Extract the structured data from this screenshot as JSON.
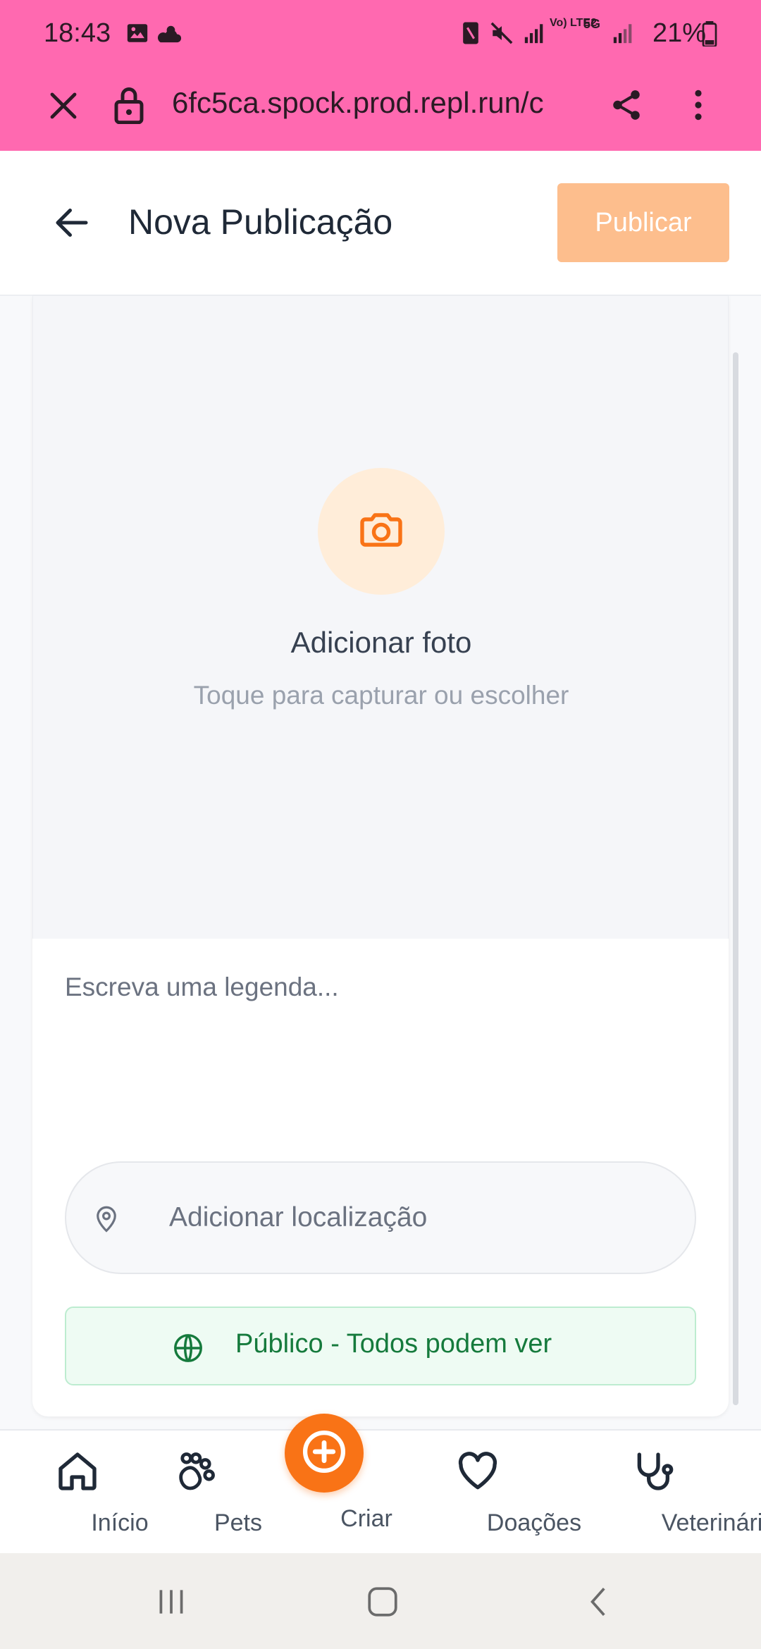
{
  "status_bar": {
    "time": "18:43",
    "battery_percent": "21%",
    "network": "5G",
    "lte_label": "Vo) LTE2"
  },
  "browser": {
    "url": "6fc5ca.spock.prod.repl.run/c"
  },
  "header": {
    "title": "Nova Publicação",
    "publish_label": "Publicar"
  },
  "photo": {
    "title": "Adicionar foto",
    "subtitle": "Toque para capturar ou escolher"
  },
  "caption": {
    "placeholder": "Escreva uma legenda..."
  },
  "location": {
    "placeholder": "Adicionar localização"
  },
  "visibility": {
    "label": "Público - Todos podem ver"
  },
  "bottom_nav": {
    "items": [
      {
        "label": "Início",
        "icon": "home-icon"
      },
      {
        "label": "Pets",
        "icon": "paw-icon"
      },
      {
        "label": "Criar",
        "icon": "plus-circle-icon"
      },
      {
        "label": "Doações",
        "icon": "heart-icon"
      },
      {
        "label": "Veterinário",
        "icon": "stethoscope-icon"
      }
    ]
  },
  "colors": {
    "status_bar_bg": "#ff69b0",
    "accent_orange": "#f97316",
    "publish_disabled": "#fdbe8d",
    "public_green": "#157a3c"
  }
}
